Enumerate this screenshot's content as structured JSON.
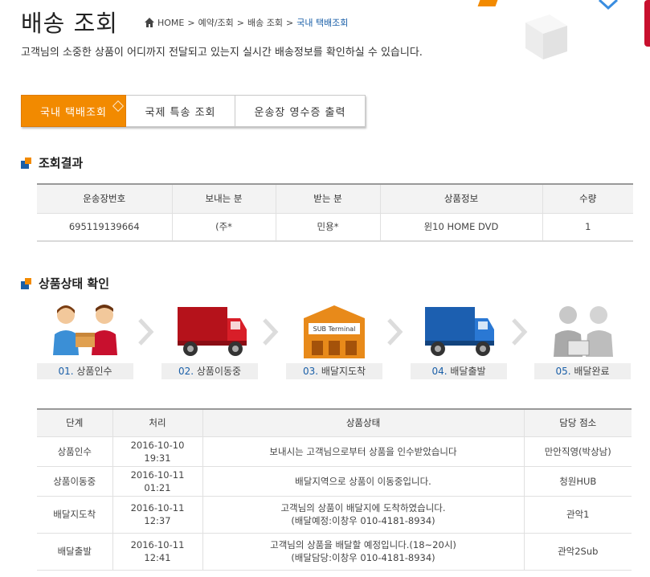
{
  "header": {
    "title": "배송 조회",
    "breadcrumb": [
      "HOME",
      "예약/조회",
      "배송 조회",
      "국내 택배조회"
    ],
    "subtitle": "고객님의 소중한 상품이 어디까지 전달되고 있는지 실시간 배송정보를 확인하실 수 있습니다."
  },
  "tabs": [
    {
      "label": "국내 택배조회",
      "active": true
    },
    {
      "label": "국제 특송 조회",
      "active": false
    },
    {
      "label": "운송장 영수증 출력",
      "active": false
    }
  ],
  "result_section": {
    "title": "조회결과",
    "columns": [
      "운송장번호",
      "보내는 분",
      "받는 분",
      "상품정보",
      "수량"
    ],
    "row": [
      "695119139664",
      "(주*",
      "민용*",
      "윈10 HOME DVD",
      "1"
    ]
  },
  "status_section": {
    "title": "상품상태 확인",
    "steps": [
      {
        "num": "01.",
        "label": "상품인수",
        "icon": "handover-icon"
      },
      {
        "num": "02.",
        "label": "상품이동중",
        "icon": "red-truck-icon"
      },
      {
        "num": "03.",
        "label": "배달지도착",
        "icon": "sub-terminal-icon"
      },
      {
        "num": "04.",
        "label": "배달출발",
        "icon": "blue-truck-icon"
      },
      {
        "num": "05.",
        "label": "배달완료",
        "icon": "delivered-icon"
      }
    ],
    "terminal_sign": "SUB Terminal",
    "columns": [
      "단계",
      "처리",
      "상품상태",
      "담당 점소"
    ],
    "rows": [
      {
        "stage": "상품인수",
        "time": "2016-10-10 19:31",
        "status": [
          "보내시는 고객님으로부터 상품을 인수받았습니다"
        ],
        "office": "만안직영(박상남)"
      },
      {
        "stage": "상품이동중",
        "time": "2016-10-11 01:21",
        "status": [
          "배달지역으로 상품이 이동중입니다."
        ],
        "office": "청원HUB"
      },
      {
        "stage": "배달지도착",
        "time": "2016-10-11 12:37",
        "status": [
          "고객님의 상품이 배달지에 도착하였습니다.",
          "(배달예정:이창우 010-4181-8934)"
        ],
        "office": "관악1"
      },
      {
        "stage": "배달출발",
        "time": "2016-10-11 12:41",
        "status": [
          "고객님의 상품을 배달할 예정입니다.(18~20시)",
          "(배달담당:이창우 010-4181-8934)"
        ],
        "office": "관악2Sub"
      }
    ]
  },
  "colors": {
    "accent": "#f28a00",
    "brand_blue": "#1a5fa8",
    "brand_red": "#c8102e"
  }
}
